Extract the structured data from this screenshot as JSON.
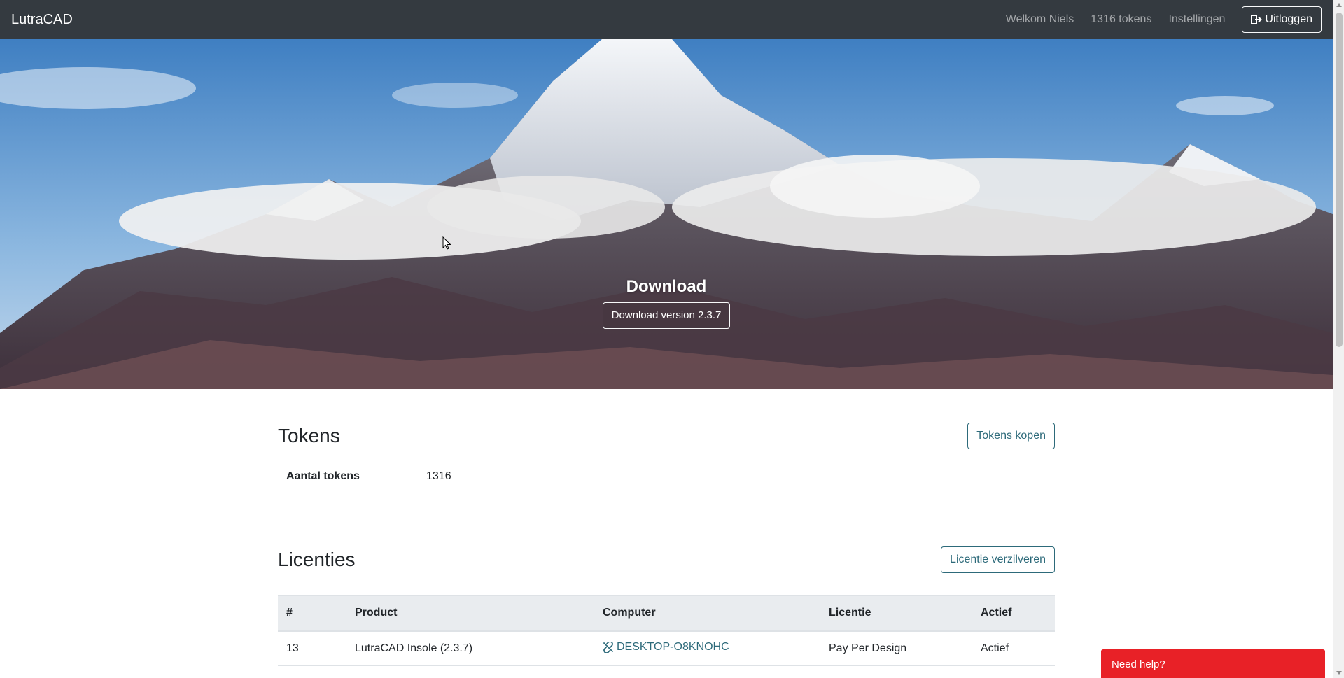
{
  "navbar": {
    "brand": "LutraCAD",
    "welcome": "Welkom Niels",
    "tokens": "1316 tokens",
    "settings": "Instellingen",
    "logout": "Uitloggen"
  },
  "hero": {
    "title": "Download",
    "button": "Download version 2.3.7"
  },
  "tokens": {
    "title": "Tokens",
    "buy_button": "Tokens kopen",
    "label": "Aantal tokens",
    "value": "1316"
  },
  "licenses": {
    "title": "Licenties",
    "redeem_button": "Licentie verzilveren",
    "columns": [
      "#",
      "Product",
      "Computer",
      "Licentie",
      "Actief"
    ],
    "rows": [
      {
        "id": "13",
        "product": "LutraCAD Insole (2.3.7)",
        "computer": "DESKTOP-O8KNOHC",
        "license": "Pay Per Design",
        "active": "Actief"
      }
    ]
  },
  "help": {
    "label": "Need help?"
  },
  "colors": {
    "navbar": "#343a40",
    "accent": "#2d6a7a",
    "help": "#e82127"
  }
}
